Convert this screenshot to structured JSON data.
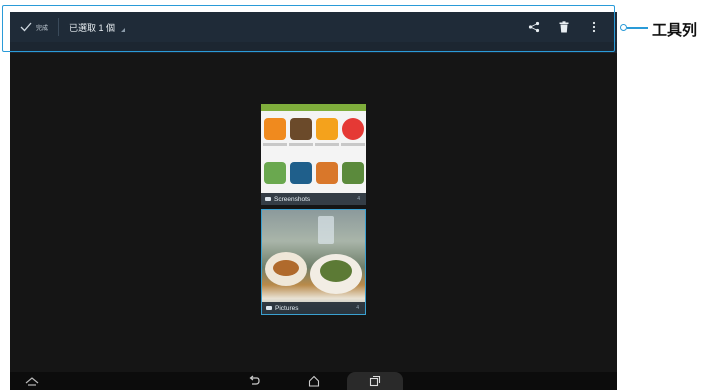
{
  "actionbar": {
    "done_label": "完成",
    "selected_text": "已選取 1 個",
    "actions": [
      "share-icon",
      "delete-icon",
      "overflow-menu-icon"
    ]
  },
  "callout": {
    "label": "工具列"
  },
  "albums": [
    {
      "name": "Screenshots",
      "count": "4"
    },
    {
      "name": "Pictures",
      "count": "4"
    }
  ],
  "navbar": {
    "buttons": [
      "up-chevron-icon",
      "back-icon",
      "home-icon",
      "recent-apps-icon"
    ]
  },
  "colors": {
    "actionbar": "#1f2b38",
    "highlight": "#2a9bd8",
    "background": "#151515"
  }
}
